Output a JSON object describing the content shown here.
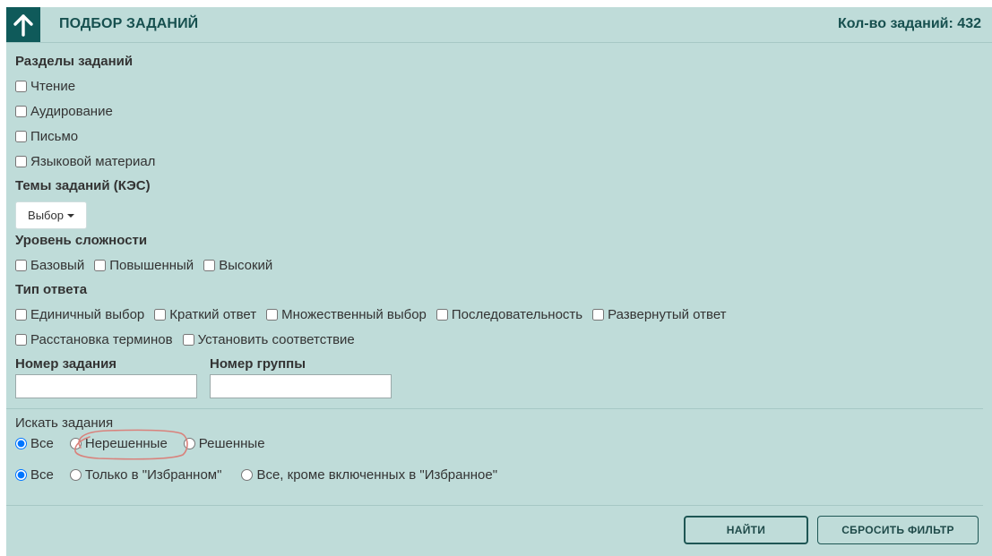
{
  "header": {
    "title": "ПОДБОР ЗАДАНИЙ",
    "count_label": "Кол-во заданий:",
    "count_value": "432"
  },
  "sections": {
    "heading": "Разделы заданий",
    "items": [
      "Чтение",
      "Аудирование",
      "Письмо",
      "Языковой материал"
    ]
  },
  "topics": {
    "heading": "Темы заданий (КЭС)",
    "select_label": "Выбор"
  },
  "difficulty": {
    "heading": "Уровень сложности",
    "items": [
      "Базовый",
      "Повышенный",
      "Высокий"
    ]
  },
  "answer_type": {
    "heading": "Тип ответа",
    "items": [
      "Единичный выбор",
      "Краткий ответ",
      "Множественный выбор",
      "Последовательность",
      "Развернутый ответ",
      "Расстановка терминов",
      "Установить соответствие"
    ]
  },
  "task_number": {
    "label": "Номер задания",
    "value": ""
  },
  "group_number": {
    "label": "Номер группы",
    "value": ""
  },
  "search": {
    "heading": "Искать задания",
    "status_options": [
      "Все",
      "Нерешенные",
      "Решенные"
    ],
    "status_selected": "Все",
    "favorites_options": [
      "Все",
      "Только в \"Избранном\"",
      "Все, кроме включенных в \"Избранное\""
    ],
    "favorites_selected": "Все"
  },
  "buttons": {
    "find": "НАЙТИ",
    "reset": "СБРОСИТЬ ФИЛЬТР"
  },
  "colors": {
    "panel_bg": "#bfdcd9",
    "accent": "#0f5a5a",
    "annotation": "#d9827c"
  },
  "icons": {
    "up": "arrow-up-icon",
    "caret": "caret-down-icon"
  }
}
